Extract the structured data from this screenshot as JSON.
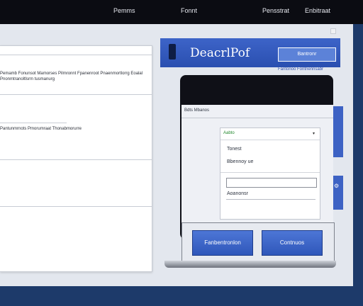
{
  "top_menu": {
    "item1": "Pemms",
    "item2": "Fonnt",
    "item3": "Pensstrat",
    "item4": "Enbitraat"
  },
  "left_panel": {
    "line1": "Pemamb Fonunsot Mamorses Pilmronnt Fpanenroot Pnaenmortlorrg Eoalal",
    "line2": "Pnonmtranoltlsrm tusmanurg",
    "line3": "Pantunmrnots Pmorumraat Thonabmorurre"
  },
  "banner": {
    "title": "DeacrlPof",
    "button_label": "Bantronr",
    "sub_link": "Fantonoo Fontnennsabr"
  },
  "device": {
    "screen_heading": "Bdts Mbanos",
    "dropdown_value": "Aabto",
    "label1": "Tonest",
    "label2": "Bbennoy ue",
    "field_value": "",
    "label3": "Aoanonsr",
    "button_left": "Fanbentronlon",
    "button_right": "Contnuos"
  },
  "icons": {
    "dropdown": "chevron-down-icon",
    "side_tab": "gear-icon",
    "logo": "app-logo-icon"
  },
  "colors": {
    "accent": "#3d62c4",
    "header": "#0b0c12",
    "background": "#1d3a6a"
  }
}
